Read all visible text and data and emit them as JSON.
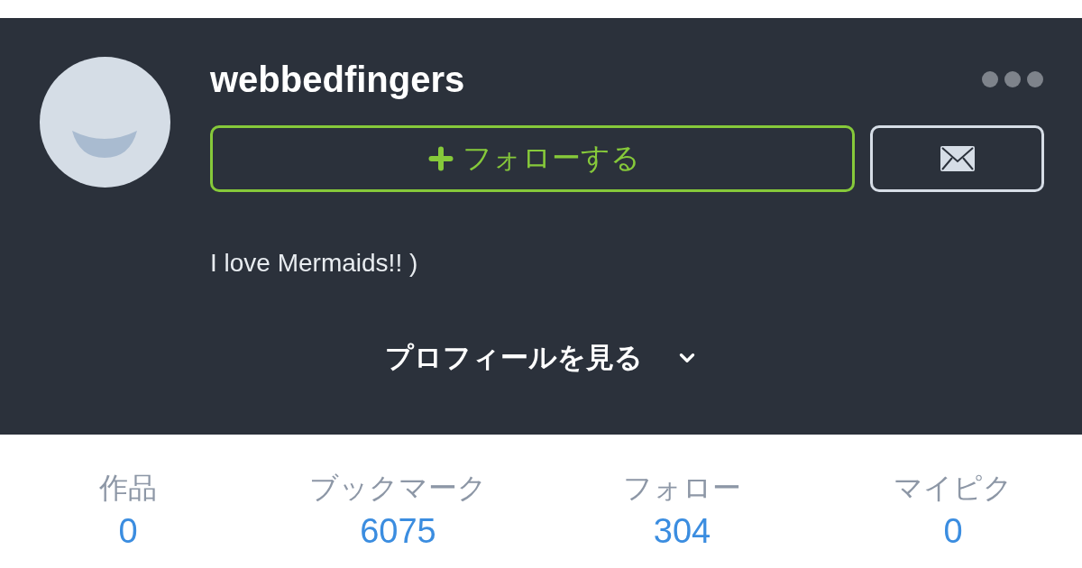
{
  "profile": {
    "username": "webbedfingers",
    "follow_button": "フォローする",
    "bio": "I love Mermaids!! )",
    "view_profile": "プロフィールを見る"
  },
  "stats": [
    {
      "label": "作品",
      "value": "0"
    },
    {
      "label": "ブックマーク",
      "value": "6075"
    },
    {
      "label": "フォロー",
      "value": "304"
    },
    {
      "label": "マイピク",
      "value": "0"
    }
  ]
}
